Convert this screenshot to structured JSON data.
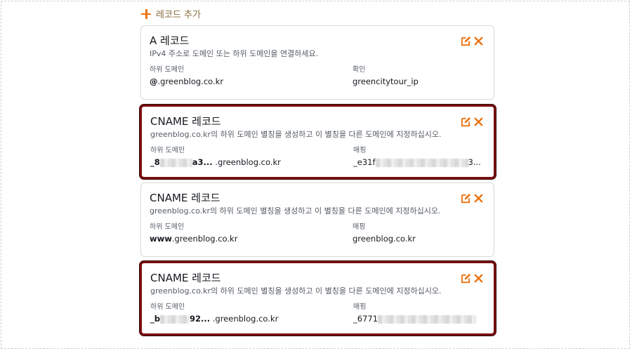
{
  "add_record": {
    "label": "레코드 추가"
  },
  "records": [
    {
      "title": "A 레코드",
      "description": "IPv4 주소로 도메인 또는 하위 도메인을 연결하세요.",
      "field1_label": "하위 도메인",
      "field1_bold": "@",
      "field1_rest": ".greenblog.co.kr",
      "field2_label": "확인",
      "field2_value": "greencitytour_ip"
    },
    {
      "title": "CNAME 레코드",
      "description": "greenblog.co.kr의 하위 도메인 별칭을 생성하고 이 별칭을 다른 도메인에 지정하십시오.",
      "field1_label": "하위 도메인",
      "field1_prefix": "_8",
      "field1_suffix": "a3...",
      "field1_rest": ".greenblog.co.kr",
      "field2_label": "매핑",
      "field2_prefix": "_e31f",
      "field2_suffix": "3..."
    },
    {
      "title": "CNAME 레코드",
      "description": "greenblog.co.kr의 하위 도메인 별칭을 생성하고 이 별칭을 다른 도메인에 지정하십시오.",
      "field1_label": "하위 도메인",
      "field1_bold": "www",
      "field1_rest": ".greenblog.co.kr",
      "field2_label": "매핑",
      "field2_value": "greenblog.co.kr"
    },
    {
      "title": "CNAME 레코드",
      "description": "greenblog.co.kr의 하위 도메인 별칭을 생성하고 이 별칭을 다른 도메인에 지정하십시오.",
      "field1_label": "하위 도메인",
      "field1_prefix": "_b",
      "field1_suffix": "92...",
      "field1_rest": ".greenblog.co.kr",
      "field2_label": "매핑",
      "field2_prefix": "_6771"
    }
  ],
  "colors": {
    "accent": "#ec7211",
    "highlight_border": "#7a1010"
  },
  "icons": {
    "add": "plus-icon",
    "edit": "edit-icon",
    "delete": "close-icon"
  }
}
